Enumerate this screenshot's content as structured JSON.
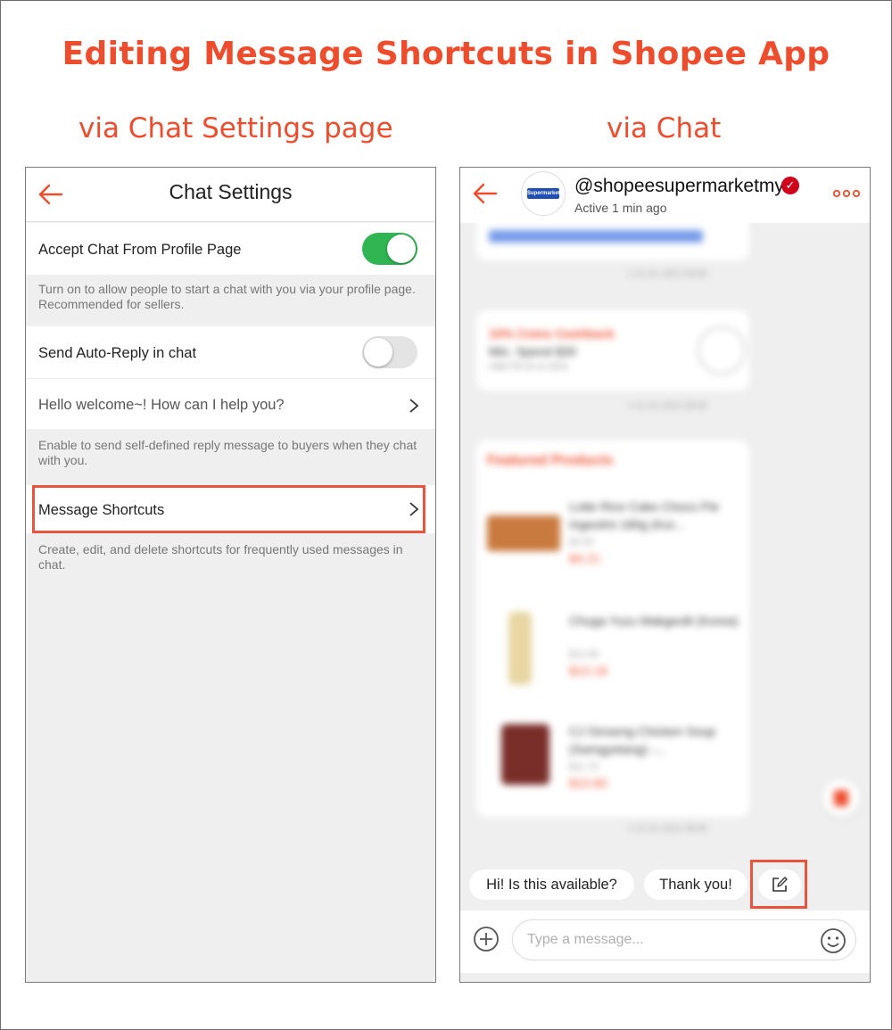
{
  "title": "Editing Message Shortcuts in Shopee App",
  "subtitles": {
    "left": "via Chat Settings page",
    "right": "via Chat"
  },
  "colors": {
    "accent": "#ee4d2d",
    "toggle_on": "#2fb551",
    "toggle_off": "#e4e4e4",
    "verified": "#d0021b",
    "highlight": "#e8553c"
  },
  "chat_settings": {
    "header_title": "Chat Settings",
    "back_icon": "back-arrow-icon",
    "accept_chat": {
      "label": "Accept Chat From Profile Page",
      "enabled": true,
      "description": "Turn on to allow people to start a chat with you via your profile page. Recommended for sellers."
    },
    "auto_reply": {
      "label": "Send Auto-Reply in chat",
      "enabled": false,
      "message": "Hello welcome~! How can I help you?",
      "description": "Enable to send self-defined reply message to buyers when they chat with you."
    },
    "message_shortcuts": {
      "label": "Message Shortcuts",
      "description": "Create, edit, and delete shortcuts for frequently used messages in chat."
    }
  },
  "chat": {
    "shop_name": "@shopeesupermarketmy",
    "avatar_text": "Supermarket",
    "status": "Active 1 min ago",
    "more_icon": "more-options-icon",
    "shortcuts": [
      "Hi! Is this available?",
      "Thank you!"
    ],
    "edit_icon": "edit-shortcuts-icon",
    "input_placeholder": "Type a message...",
    "blurred": {
      "voucher_title": "10% Coins Cashback",
      "voucher_sub": "Min. Spend $30",
      "voucher_valid": "Valid Till 10-11-2021",
      "featured_title": "Featured Products",
      "products": [
        {
          "name": "Lotte Rice Cake Choco Pie Ingeolmi 180g (Kor...",
          "old": "$4.50",
          "price": "$4.21"
        },
        {
          "name": "Chuga Yuzu Makgeolli (Korea)",
          "old": "$12.60",
          "price": "$10.18"
        },
        {
          "name": "CJ Ginseng Chicken Soup (Samgyetang) -...",
          "old": "$11.70",
          "price": "$10.80"
        }
      ],
      "timestamps": [
        "1 11:10, 2021 08:08",
        "1 11:10, 2021 08:08",
        "1 11:10, 2021 08:08"
      ]
    }
  }
}
